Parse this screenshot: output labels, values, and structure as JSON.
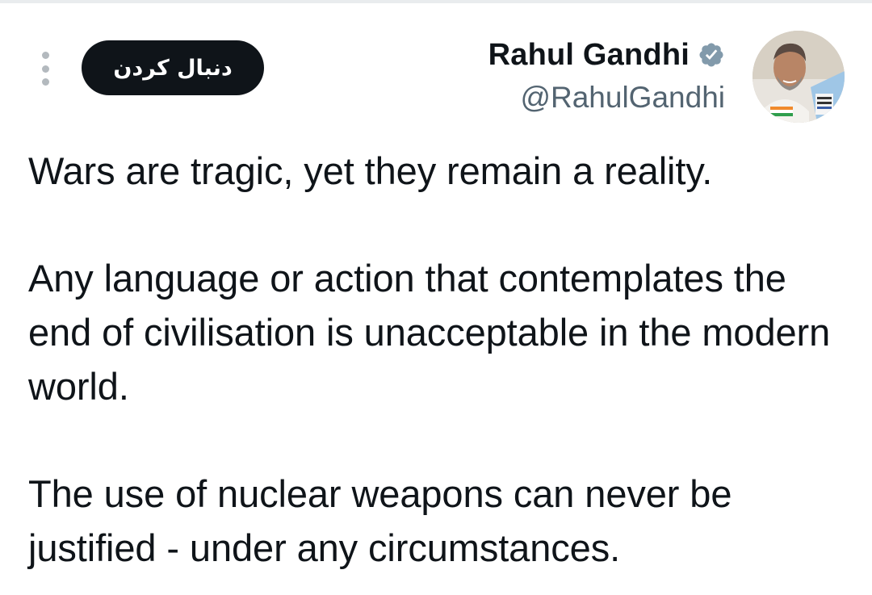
{
  "tweet": {
    "author": {
      "display_name": "Rahul Gandhi",
      "handle": "@RahulGandhi",
      "verified": true,
      "verified_color": "#829aab",
      "avatar_icon": "profile-photo"
    },
    "follow_label": "دنبال کردن",
    "more_icon": "vertical-ellipsis-icon",
    "paragraphs": [
      "Wars are tragic, yet they remain a reality.",
      "Any language or action that contemplates the end of civilisation is unacceptable in the modern world.",
      "The use of nuclear weapons can never be justified - under any circumstances."
    ]
  },
  "colors": {
    "text_primary": "#0f1419",
    "text_secondary": "#536471",
    "button_bg": "#0f1419",
    "button_text": "#ffffff"
  }
}
